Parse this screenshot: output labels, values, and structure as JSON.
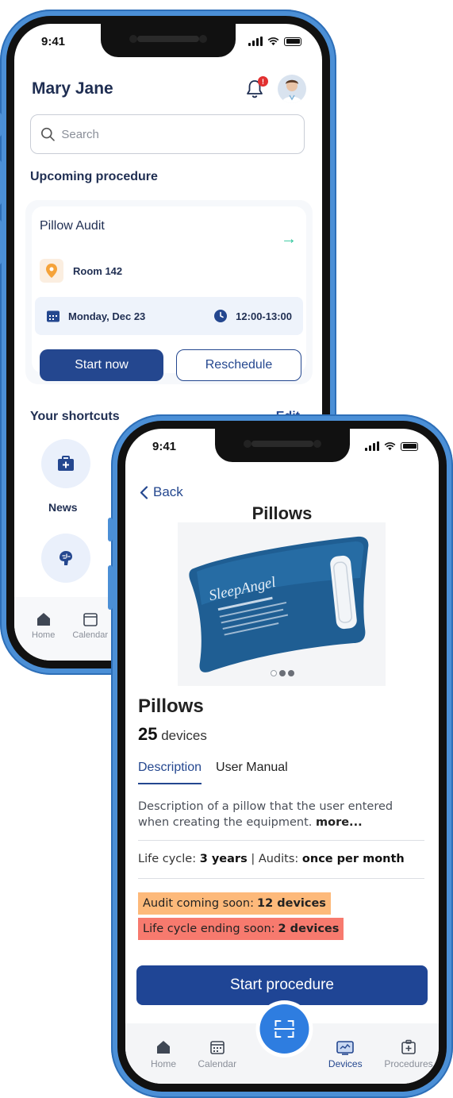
{
  "colors": {
    "brand": "#24478f",
    "accent": "#2e7de0",
    "success": "#2cc59a",
    "warning": "#fdb97a",
    "danger": "#f77a6e"
  },
  "home_screen": {
    "status_time": "9:41",
    "user_name": "Mary Jane",
    "notification_count": "!",
    "search": {
      "placeholder": "Search"
    },
    "upcoming_title": "Upcoming procedure",
    "procedure": {
      "name": "Pillow Audit",
      "room": "Room 142",
      "date": "Monday, Dec 23",
      "time": "12:00-13:00",
      "start_label": "Start now",
      "reschedule_label": "Reschedule"
    },
    "shortcuts": {
      "title": "Your shortcuts",
      "edit_label": "Edit",
      "items": [
        {
          "label": "News",
          "icon": "first-aid-kit-icon"
        },
        {
          "label": "",
          "icon": "brain-icon"
        }
      ]
    },
    "tabbar": [
      {
        "label": "Home",
        "icon": "home-icon"
      },
      {
        "label": "Calendar",
        "icon": "calendar-icon"
      }
    ]
  },
  "device_screen": {
    "status_time": "9:41",
    "back_label": "Back",
    "title": "Pillows",
    "carousel": {
      "total": 3,
      "active": 1
    },
    "product_name": "Pillows",
    "device_count": "25",
    "device_unit": "devices",
    "tabs": [
      {
        "label": "Description",
        "active": true
      },
      {
        "label": "User Manual",
        "active": false
      }
    ],
    "description": "Description of a pillow that the user entered when creating the equipment.",
    "more_label": "more...",
    "lifecycle": {
      "label": "Life cycle:",
      "value": "3 years",
      "separator": "|",
      "audits_label": "Audits:",
      "audits_value": "once per month"
    },
    "alerts": {
      "audit_label": "Audit coming soon:",
      "audit_value": "12 devices",
      "lifecycle_label": "Life cycle ending soon:",
      "lifecycle_value": "2 devices"
    },
    "start_label": "Start procedure",
    "tabbar": [
      {
        "label": "Home",
        "icon": "home-icon",
        "active": false
      },
      {
        "label": "Calendar",
        "icon": "calendar-icon",
        "active": false
      },
      {
        "label": "Devices",
        "icon": "devices-icon",
        "active": true
      },
      {
        "label": "Procedures",
        "icon": "procedures-icon",
        "active": false
      }
    ]
  }
}
